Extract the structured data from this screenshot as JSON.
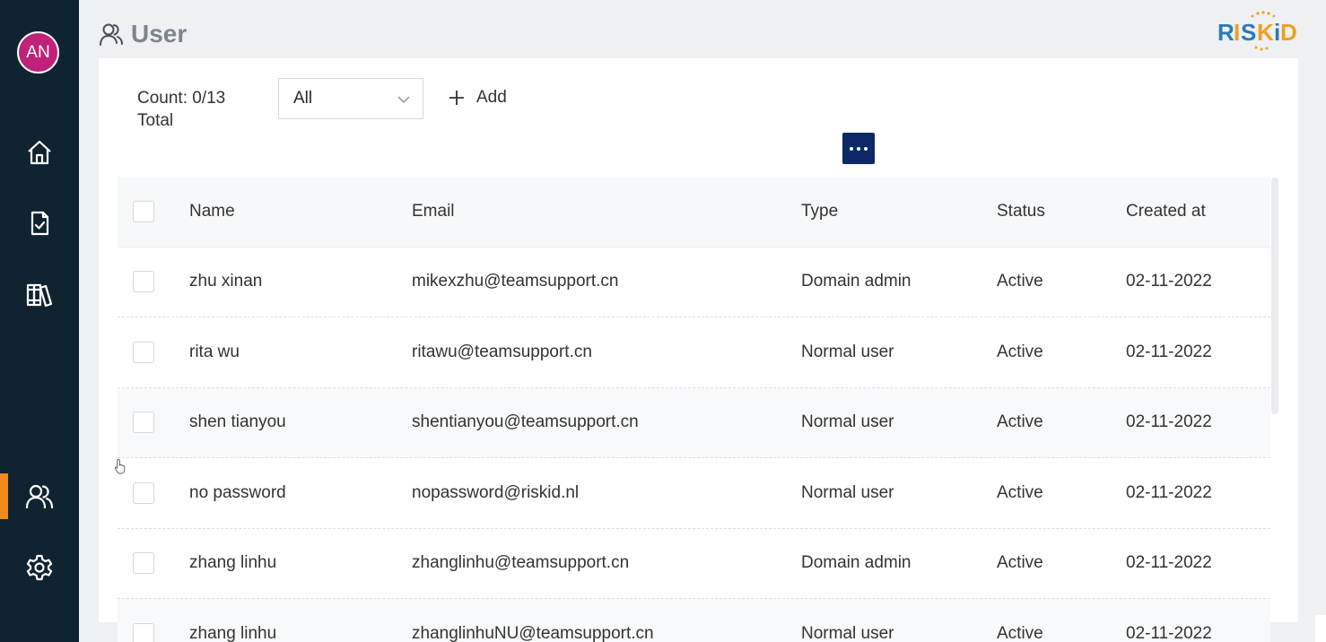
{
  "user": {
    "initials": "AN",
    "avatar_color": "#c0217a"
  },
  "sidebar": {
    "items": [
      {
        "id": "home",
        "icon": "home-icon"
      },
      {
        "id": "tasks",
        "icon": "clipboard-check-icon"
      },
      {
        "id": "library",
        "icon": "books-icon"
      },
      {
        "id": "users",
        "icon": "users-icon",
        "active": true
      },
      {
        "id": "settings",
        "icon": "gear-icon"
      }
    ],
    "active_color": "#f08a1c",
    "background": "#0f2430"
  },
  "page": {
    "title": "User",
    "icon": "user-icon"
  },
  "brand": {
    "logo_text": "RISKiD",
    "color_blue": "#2a7ab8",
    "color_orange": "#f0a020"
  },
  "toolbar": {
    "count_label": "Count: 0/13",
    "count_suffix": "Total",
    "filter_value": "All",
    "add_label": "Add",
    "more_color": "#0c2868"
  },
  "table": {
    "headers": {
      "name": "Name",
      "email": "Email",
      "type": "Type",
      "status": "Status",
      "created": "Created at"
    },
    "rows": [
      {
        "name": "zhu xinan",
        "email": "mikexzhu@teamsupport.cn",
        "type": "Domain admin",
        "status": "Active",
        "created": "02-11-2022"
      },
      {
        "name": "rita wu",
        "email": "ritawu@teamsupport.cn",
        "type": "Normal user",
        "status": "Active",
        "created": "02-11-2022"
      },
      {
        "name": "shen tianyou",
        "email": "shentianyou@teamsupport.cn",
        "type": "Normal user",
        "status": "Active",
        "created": "02-11-2022"
      },
      {
        "name": "no password",
        "email": "nopassword@riskid.nl",
        "type": "Normal user",
        "status": "Active",
        "created": "02-11-2022"
      },
      {
        "name": "zhang linhu",
        "email": "zhanglinhu@teamsupport.cn",
        "type": "Domain admin",
        "status": "Active",
        "created": "02-11-2022"
      },
      {
        "name": "zhang linhu",
        "email": "zhanglinhuNU@teamsupport.cn",
        "type": "Normal user",
        "status": "Active",
        "created": "02-11-2022"
      }
    ]
  }
}
